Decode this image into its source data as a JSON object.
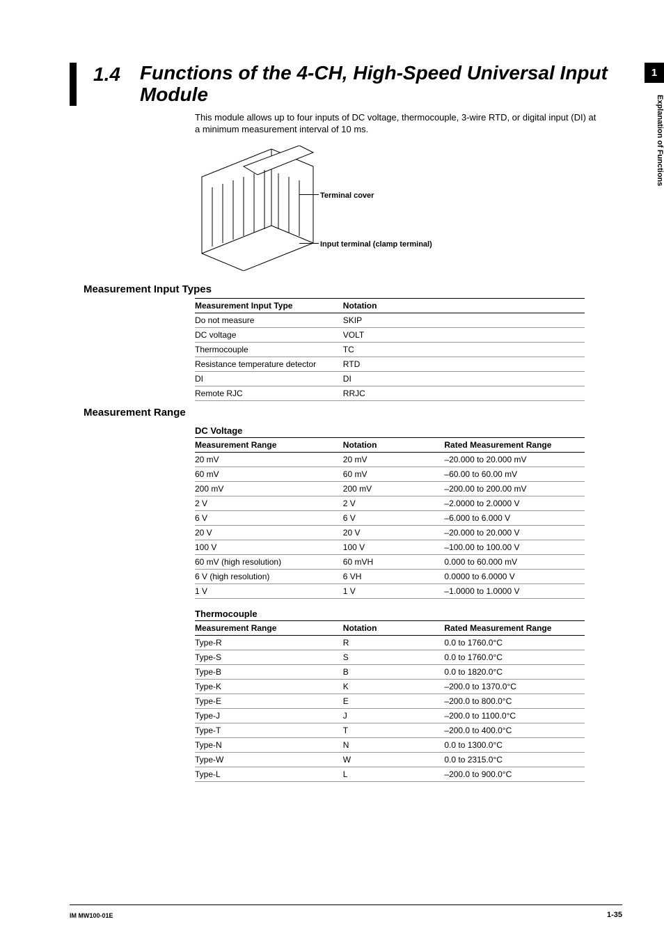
{
  "side": {
    "chapter": "1",
    "label": "Explanation of Functions"
  },
  "heading": {
    "num": "1.4",
    "title": "Functions of the 4-CH, High-Speed Universal Input Module"
  },
  "intro": "This module allows up to four inputs of DC voltage, thermocouple, 3-wire RTD, or digital input (DI) at a minimum measurement interval of 10 ms.",
  "figure": {
    "label1": "Terminal cover",
    "label2": "Input terminal (clamp terminal)"
  },
  "sections": {
    "inputTypes": {
      "title": "Measurement Input Types",
      "headers": [
        "Measurement Input Type",
        "Notation"
      ],
      "rows": [
        [
          "Do not measure",
          "SKIP"
        ],
        [
          "DC voltage",
          "VOLT"
        ],
        [
          "Thermocouple",
          "TC"
        ],
        [
          "Resistance temperature detector",
          "RTD"
        ],
        [
          "DI",
          "DI"
        ],
        [
          "Remote RJC",
          "RRJC"
        ]
      ]
    },
    "range": {
      "title": "Measurement Range",
      "dcVoltage": {
        "title": "DC Voltage",
        "headers": [
          "Measurement Range",
          "Notation",
          "Rated Measurement Range"
        ],
        "rows": [
          [
            "20 mV",
            "20 mV",
            "–20.000 to 20.000 mV"
          ],
          [
            "60 mV",
            "60 mV",
            "–60.00 to 60.00 mV"
          ],
          [
            "200 mV",
            "200 mV",
            "–200.00 to 200.00 mV"
          ],
          [
            "2 V",
            "2 V",
            "–2.0000 to 2.0000 V"
          ],
          [
            "6 V",
            "6 V",
            "–6.000 to 6.000 V"
          ],
          [
            "20 V",
            "20 V",
            "–20.000 to 20.000 V"
          ],
          [
            "100 V",
            "100 V",
            "–100.00 to 100.00 V"
          ],
          [
            "60 mV (high resolution)",
            "60 mVH",
            "0.000 to 60.000 mV"
          ],
          [
            "6 V (high resolution)",
            "6 VH",
            "0.0000 to 6.0000 V"
          ],
          [
            "1 V",
            "1 V",
            "–1.0000 to 1.0000 V"
          ]
        ]
      },
      "thermocouple": {
        "title": "Thermocouple",
        "headers": [
          "Measurement Range",
          "Notation",
          "Rated Measurement Range"
        ],
        "rows": [
          [
            "Type-R",
            "R",
            "0.0 to 1760.0°C"
          ],
          [
            "Type-S",
            "S",
            "0.0 to 1760.0°C"
          ],
          [
            "Type-B",
            "B",
            "0.0 to 1820.0°C"
          ],
          [
            "Type-K",
            "K",
            "–200.0 to 1370.0°C"
          ],
          [
            "Type-E",
            "E",
            "–200.0 to 800.0°C"
          ],
          [
            "Type-J",
            "J",
            "–200.0 to 1100.0°C"
          ],
          [
            "Type-T",
            "T",
            "–200.0 to 400.0°C"
          ],
          [
            "Type-N",
            "N",
            "0.0 to 1300.0°C"
          ],
          [
            "Type-W",
            "W",
            "0.0 to 2315.0°C"
          ],
          [
            "Type-L",
            "L",
            "–200.0 to 900.0°C"
          ]
        ]
      }
    }
  },
  "footer": {
    "left": "IM MW100-01E",
    "right": "1-35"
  }
}
